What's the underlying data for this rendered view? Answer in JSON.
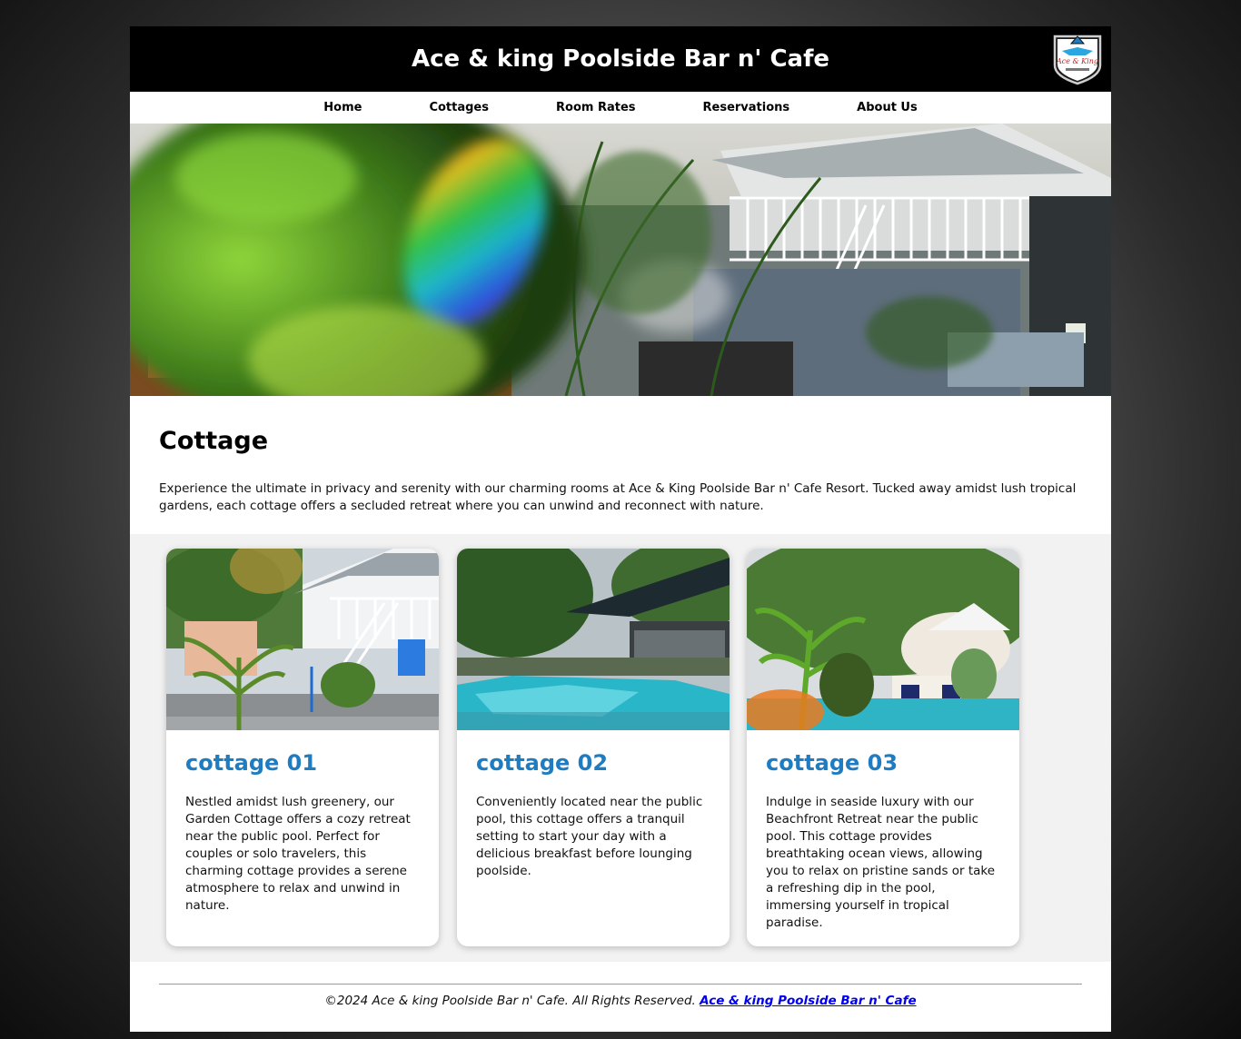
{
  "header": {
    "title": "Ace & king Poolside Bar n' Cafe",
    "logo_text": "Ace & King"
  },
  "nav": {
    "items": [
      "Home",
      "Cottages",
      "Room Rates",
      "Reservations",
      "About Us"
    ]
  },
  "intro": {
    "heading": "Cottage",
    "text": "Experience the ultimate in privacy and serenity with our charming rooms at Ace & King Poolside Bar n' Cafe Resort. Tucked away amidst lush tropical gardens, each cottage offers a secluded retreat where you can unwind and reconnect with nature."
  },
  "cards": [
    {
      "title": "cottage 01",
      "text": "Nestled amidst lush greenery, our Garden Cottage offers a cozy retreat near the public pool. Perfect for couples or solo travelers, this charming cottage provides a serene atmosphere to relax and unwind in nature."
    },
    {
      "title": "cottage 02",
      "text": "Conveniently located near the public pool, this cottage offers a tranquil setting to start your day with a delicious breakfast before lounging poolside."
    },
    {
      "title": "cottage 03",
      "text": "Indulge in seaside luxury with our Beachfront Retreat near the public pool. This cottage provides breathtaking ocean views, allowing you to relax on pristine sands or take a refreshing dip in the pool, immersing yourself in tropical paradise."
    }
  ],
  "footer": {
    "text": "©2024 Ace & king Poolside Bar n' Cafe. All Rights Reserved.",
    "link": "Ace & king Poolside Bar n' Cafe"
  },
  "colors": {
    "header_bg": "#000000",
    "card_title": "#1f7cc1",
    "cards_bg": "#f2f2f2",
    "link": "#0000ee"
  }
}
